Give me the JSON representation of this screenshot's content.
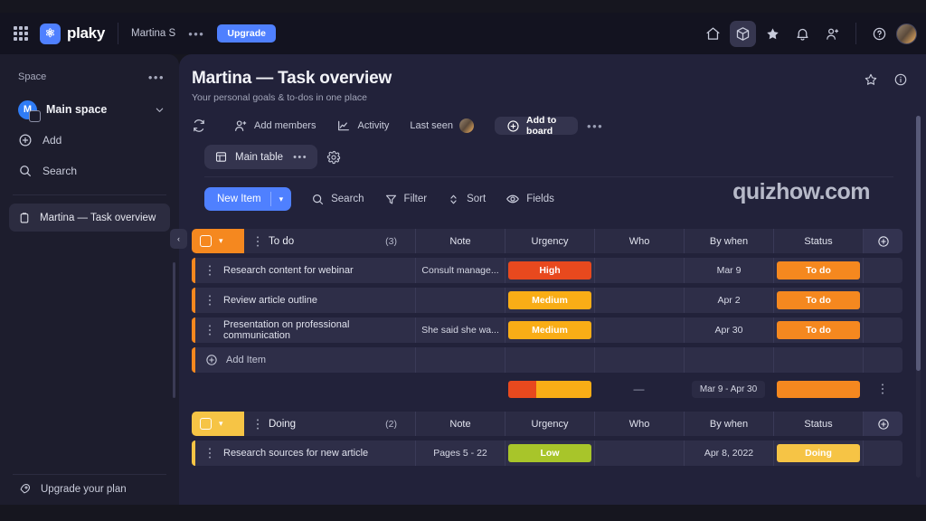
{
  "topbar": {
    "grid_icon": "apps-grid-icon",
    "brand": "plaky",
    "workspace": "Martina S",
    "more": "•••",
    "upgrade": "Upgrade",
    "icons": [
      {
        "name": "home-icon",
        "active": false
      },
      {
        "name": "boards-cube-icon",
        "active": true
      },
      {
        "name": "star-icon",
        "active": false
      },
      {
        "name": "bell-notifications-icon",
        "active": false
      },
      {
        "name": "invite-person-icon",
        "active": false
      },
      {
        "name": "help-question-icon",
        "active": false
      }
    ]
  },
  "sidebar": {
    "section_label": "Space",
    "section_more": "•••",
    "space": {
      "initial": "M",
      "name": "Main space"
    },
    "nav": [
      {
        "label": "Add",
        "icon": "plus-circle-icon"
      },
      {
        "label": "Search",
        "icon": "search-icon"
      }
    ],
    "boards": [
      {
        "label": "Martina — Task overview",
        "icon": "clipboard-icon",
        "active": true
      }
    ],
    "footer": {
      "label": "Upgrade your plan",
      "icon": "rocket-icon"
    },
    "collapse": "‹"
  },
  "board": {
    "title": "Martina — Task overview",
    "subtitle": "Your personal goals & to-dos in one place",
    "actions": [
      {
        "label": "",
        "icon": "refresh-sync-icon"
      },
      {
        "label": "Add members",
        "icon": "add-member-icon"
      },
      {
        "label": "Activity",
        "icon": "activity-chart-icon"
      },
      {
        "label": "Last seen",
        "icon": "last-seen-avatar"
      },
      {
        "label": "Add to board",
        "icon": "plus-circle-icon"
      },
      {
        "label": "•••",
        "icon": "more-options-icon"
      }
    ],
    "head_right": [
      {
        "icon": "star-outline-icon"
      },
      {
        "icon": "info-circle-icon"
      }
    ],
    "tab": {
      "label": "Main table",
      "icon": "table-layout-icon",
      "more": "•••"
    },
    "settings_icon": "gear-icon",
    "toolbar": {
      "new_item": "New Item",
      "new_item_caret": "▾",
      "buttons": [
        {
          "label": "Search",
          "icon": "search-icon"
        },
        {
          "label": "Filter",
          "icon": "filter-funnel-icon"
        },
        {
          "label": "Sort",
          "icon": "sort-updown-icon"
        },
        {
          "label": "Fields",
          "icon": "eye-fields-icon"
        }
      ]
    },
    "watermark": "quizhow.com"
  },
  "colors": {
    "accent_blue": "#4f80ff",
    "todo_orange": "#f5881f",
    "doing_amber": "#f6c445",
    "urgency_high": "#e8491e",
    "urgency_medium": "#f9ad16",
    "urgency_low": "#a8c52a"
  },
  "table": {
    "columns": [
      "Note",
      "Urgency",
      "Who",
      "By when",
      "Status"
    ],
    "add_item_label": "Add Item",
    "add_column_icon": "plus-circle-icon",
    "groups": [
      {
        "name": "To do",
        "count": "(3)",
        "color": "#f5881f",
        "rows": [
          {
            "name": "Research content for webinar",
            "note": "Consult manage...",
            "urgency": {
              "label": "High",
              "color": "#e8491e"
            },
            "who": "",
            "by_when": "Mar 9",
            "status": {
              "label": "To do",
              "color": "#f5881f"
            }
          },
          {
            "name": "Review article outline",
            "note": "",
            "urgency": {
              "label": "Medium",
              "color": "#f9ad16"
            },
            "who": "",
            "by_when": "Apr 2",
            "status": {
              "label": "To do",
              "color": "#f5881f"
            }
          },
          {
            "name": "Presentation on professional communication",
            "note": "She said she wa...",
            "urgency": {
              "label": "Medium",
              "color": "#f9ad16"
            },
            "who": "",
            "by_when": "Apr 30",
            "status": {
              "label": "To do",
              "color": "#f5881f"
            }
          }
        ],
        "summary": {
          "urgency_segments": [
            {
              "color": "#e8491e",
              "pct": 34
            },
            {
              "color": "#f9ad16",
              "pct": 66
            }
          ],
          "who": "—",
          "by_when": "Mar 9 - Apr 30",
          "status_segments": [
            {
              "color": "#f5881f",
              "pct": 100
            }
          ],
          "kebab": "⋮"
        }
      },
      {
        "name": "Doing",
        "count": "(2)",
        "color": "#f6c445",
        "rows": [
          {
            "name": "Research sources for new article",
            "note": "Pages 5 - 22",
            "urgency": {
              "label": "Low",
              "color": "#a8c52a"
            },
            "who": "",
            "by_when": "Apr 8, 2022",
            "status": {
              "label": "Doing",
              "color": "#f6c445"
            }
          }
        ]
      }
    ]
  }
}
